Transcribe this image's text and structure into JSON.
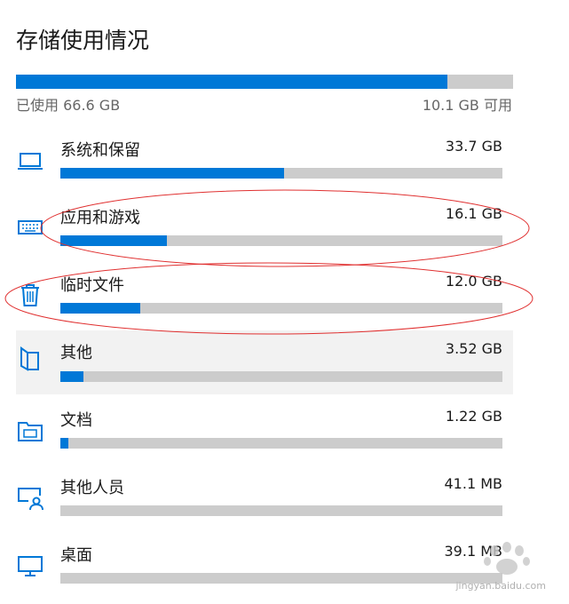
{
  "page": {
    "title": "存储使用情况"
  },
  "summary": {
    "used_label": "已使用 66.6 GB",
    "free_label": "10.1 GB 可用",
    "used_fraction": 0.868
  },
  "categories": [
    {
      "name": "系统和保留",
      "size": "33.7 GB",
      "fraction": 0.506,
      "icon": "laptop-icon"
    },
    {
      "name": "应用和游戏",
      "size": "16.1 GB",
      "fraction": 0.241,
      "icon": "keyboard-icon"
    },
    {
      "name": "临时文件",
      "size": "12.0 GB",
      "fraction": 0.18,
      "icon": "trash-icon"
    },
    {
      "name": "其他",
      "size": "3.52 GB",
      "fraction": 0.053,
      "icon": "folder-icon",
      "highlighted": true
    },
    {
      "name": "文档",
      "size": "1.22 GB",
      "fraction": 0.018,
      "icon": "documents-folder-icon"
    },
    {
      "name": "其他人员",
      "size": "41.1 MB",
      "fraction": 0.0,
      "icon": "user-desktop-icon"
    },
    {
      "name": "桌面",
      "size": "39.1 MB",
      "fraction": 0.0,
      "icon": "monitor-icon"
    }
  ],
  "colors": {
    "accent": "#0078d7",
    "track": "#cccccc",
    "annotation": "#e03030"
  },
  "watermark": {
    "text": "jingyan.baidu.com"
  }
}
